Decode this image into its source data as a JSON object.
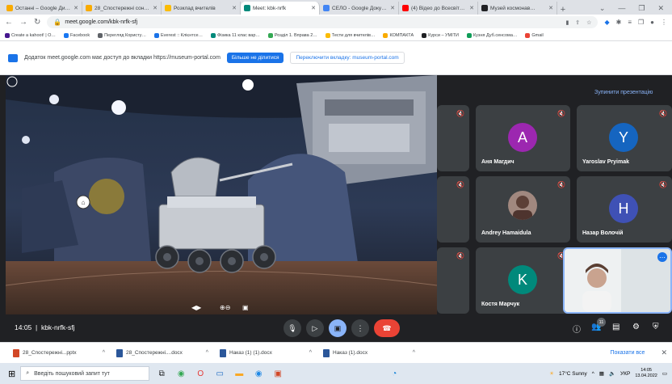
{
  "tabs": [
    {
      "label": "Останні – Google Ди…",
      "color": "#f9ab00",
      "active": false
    },
    {
      "label": "28_Спостережні сон…",
      "color": "#f9ab00",
      "active": false
    },
    {
      "label": "Розклад вчителів",
      "color": "#fbbc04",
      "active": false
    },
    {
      "label": "Meet: kbk-nrfk",
      "color": "#00897b",
      "active": true
    },
    {
      "label": "СЕЛО - Google Доку…",
      "color": "#4285f4",
      "active": false
    },
    {
      "label": "(4) Відео до Всесвіт…",
      "color": "#ff0000",
      "active": false
    },
    {
      "label": "Музей космонав…",
      "color": "#202124",
      "active": false
    }
  ],
  "omnibox": {
    "url": "meet.google.com/kbk-nrfk-sfj"
  },
  "bookmarks": [
    {
      "label": "Create a kahoot! | O…",
      "color": "#46178f"
    },
    {
      "label": "Facebook",
      "color": "#1877f2"
    },
    {
      "label": "Перегляд Користу…",
      "color": "#5f6368"
    },
    {
      "label": "Everest :: Клієнтсе…",
      "color": "#1a73e8"
    },
    {
      "label": "Фізика 11 клас вар…",
      "color": "#00897b"
    },
    {
      "label": "Розділ 1. Вправа 2…",
      "color": "#34a853"
    },
    {
      "label": "Тести для вчителів…",
      "color": "#fbbc04"
    },
    {
      "label": "КОМПАКТА",
      "color": "#f9ab00"
    },
    {
      "label": "Курси – УМІТИ",
      "color": "#202124"
    },
    {
      "label": "Кузня Дуб.сенсома…",
      "color": "#0f9d58"
    },
    {
      "label": "Gmail",
      "color": "#ea4335"
    }
  ],
  "infobar": {
    "message": "Додаток meet.google.com має доступ до вкладки https://museum-portal.com",
    "stop_sharing": "Більше не ділитися",
    "switch_tab": "Переключити вкладку: museum-portal.com"
  },
  "meeting": {
    "stop_presenting": "Зупинити презентацію",
    "time": "14:05",
    "code": "kbk-nrfk-sfj",
    "participants_count": "11"
  },
  "participants": [
    {
      "name": "Аня Магдич",
      "initial": "A",
      "color": "#9c27b0"
    },
    {
      "name": "Yaroslav Pryimak",
      "initial": "Y",
      "color": "#1565c0"
    },
    {
      "name": "Andrey Hamaidula",
      "initial": "",
      "color": "#8d6e63"
    },
    {
      "name": "Назар Волочій",
      "initial": "H",
      "color": "#3f51b5"
    },
    {
      "name": "Костя Марчук",
      "initial": "K",
      "color": "#00897b"
    }
  ],
  "downloads": [
    {
      "label": "28_Спостережні...pptx",
      "type": "ppt"
    },
    {
      "label": "28_Спостережні....docx",
      "type": "doc"
    },
    {
      "label": "Наказ (1) (1).docx",
      "type": "doc"
    },
    {
      "label": "Наказ (1).docx",
      "type": "doc"
    }
  ],
  "downloads_show_all": "Показати все",
  "taskbar": {
    "search_placeholder": "Введіть пошуковий запит тут",
    "weather": "17°C Sunny",
    "lang": "УКР",
    "time": "14:05",
    "date": "13.04.2022"
  }
}
